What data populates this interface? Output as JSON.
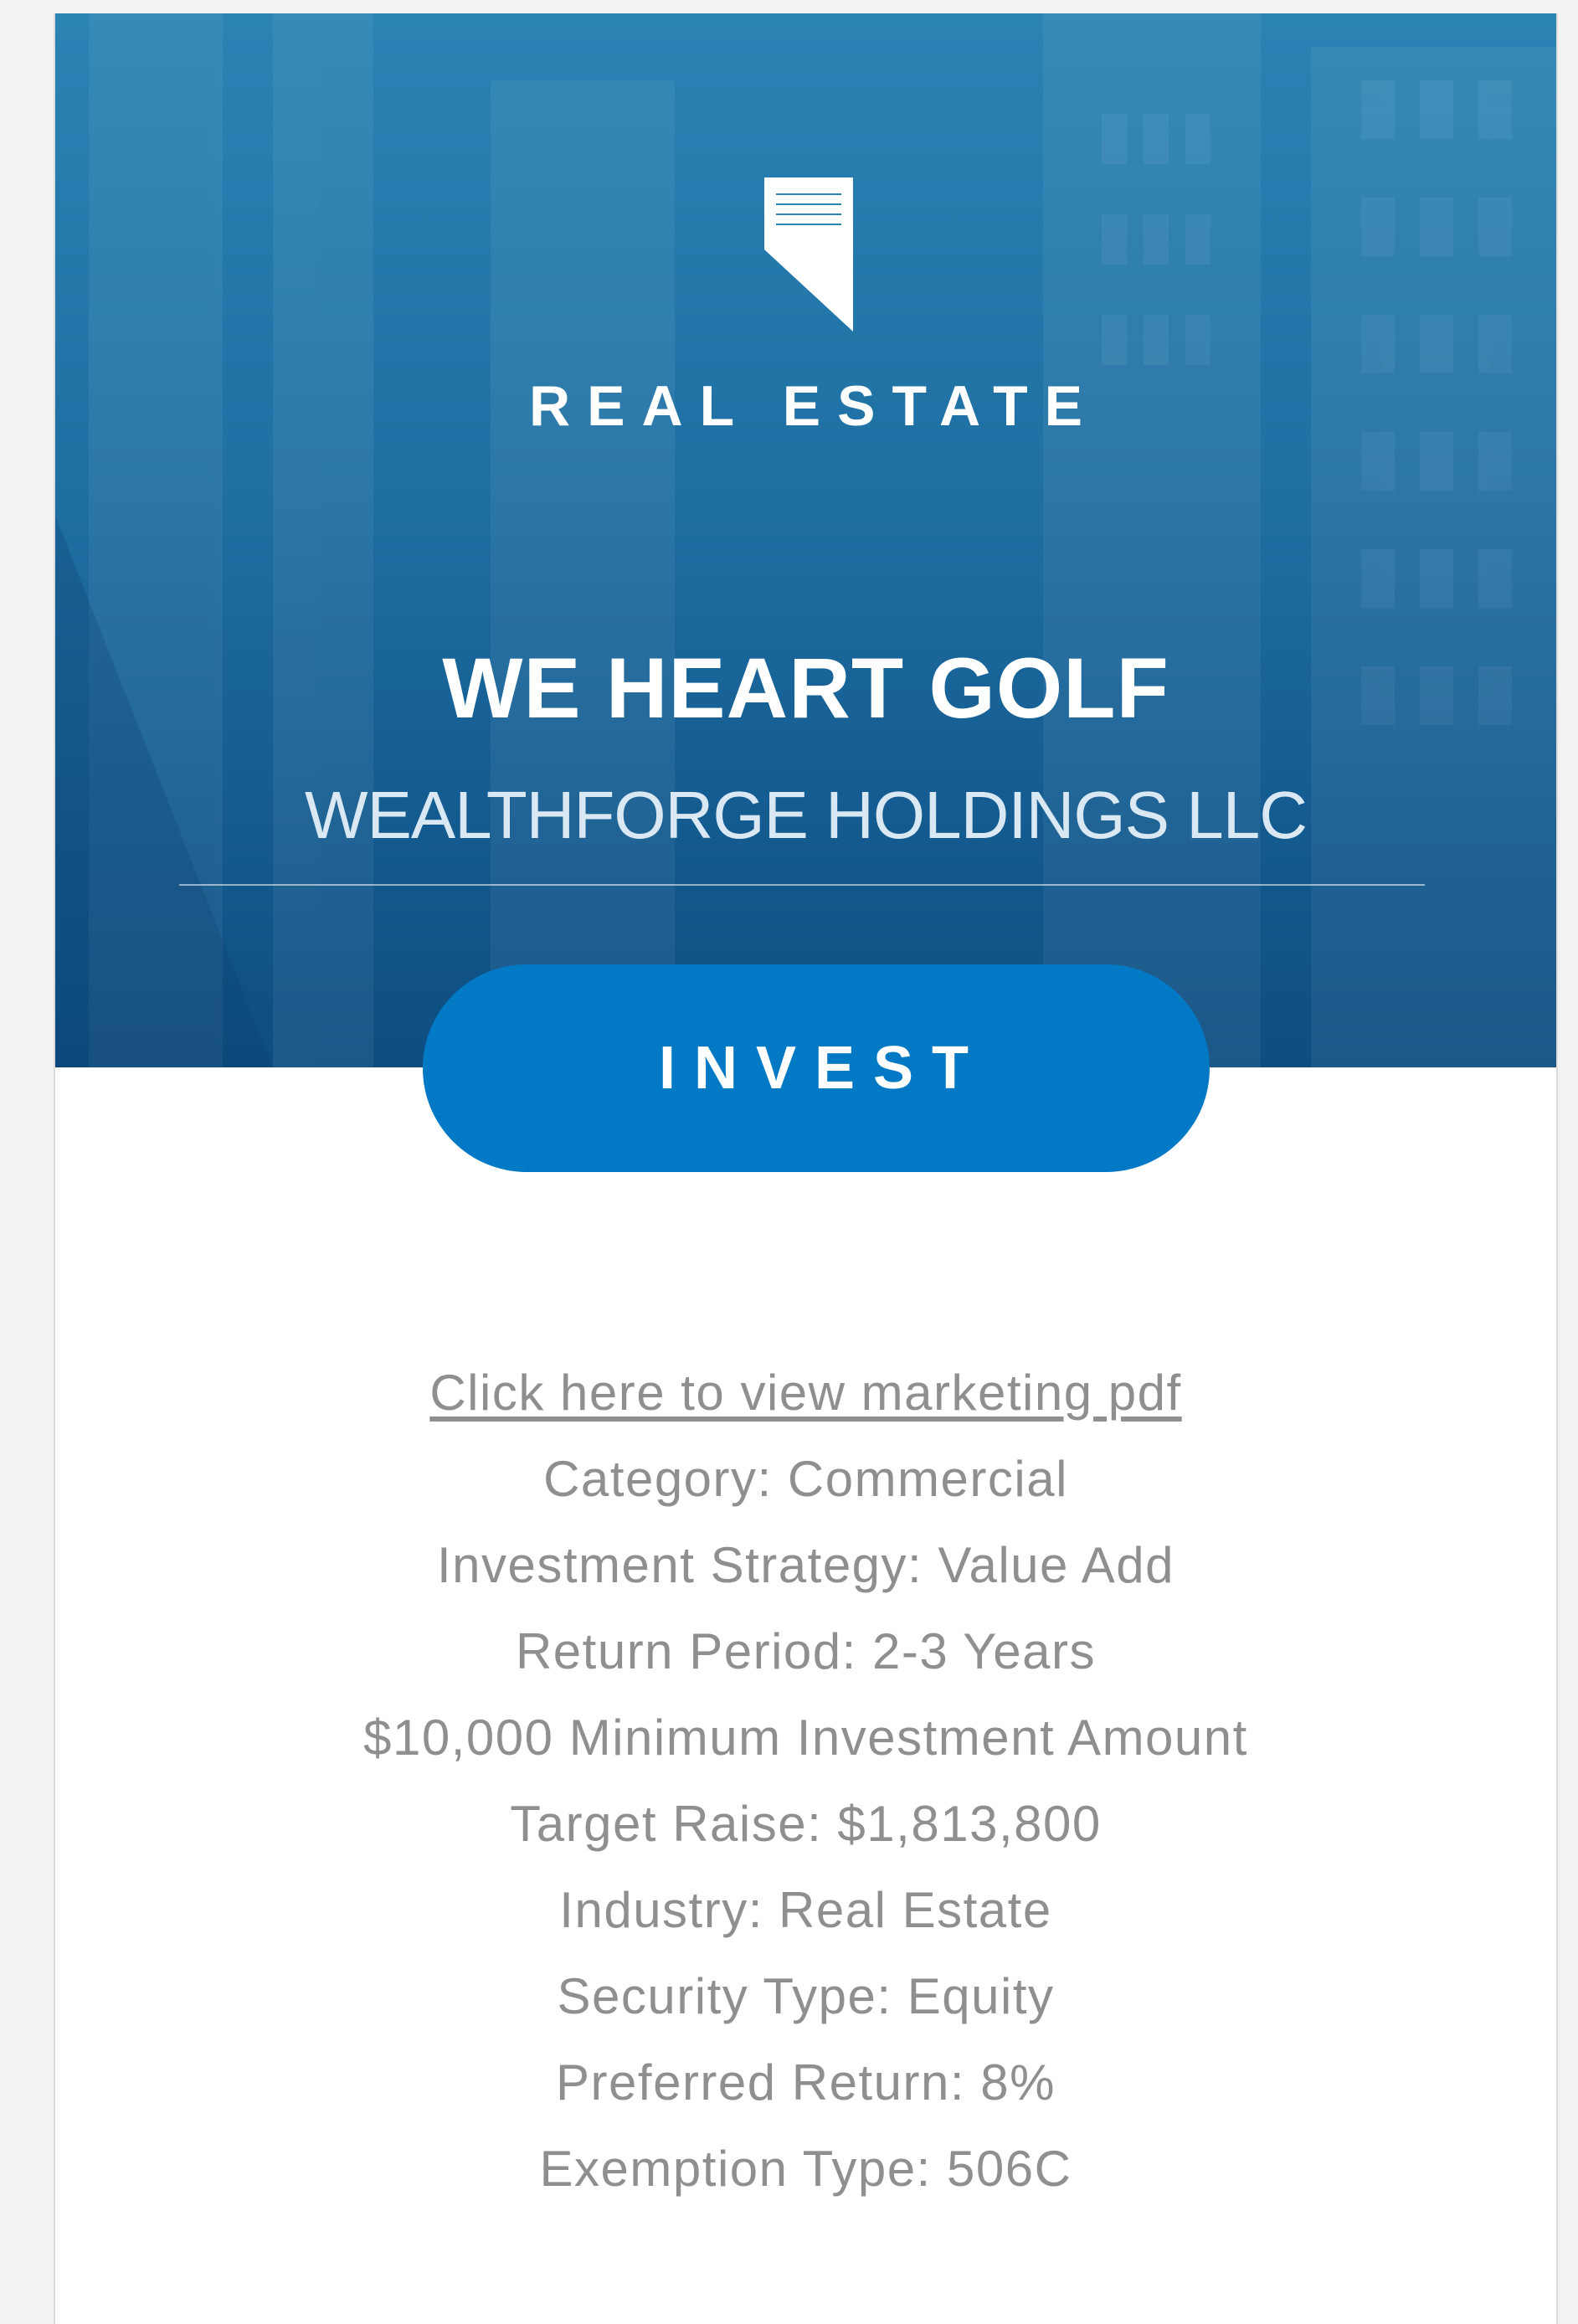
{
  "hero": {
    "category": "REAL ESTATE",
    "title": "WE HEART GOLF",
    "subtitle": "WEALTHFORGE HOLDINGS LLC",
    "logo_icon": "real-estate-logo-icon"
  },
  "invest_button": {
    "label": "INVEST"
  },
  "details": {
    "marketing_link": "Click here to view marketing pdf",
    "lines": [
      "Category: Commercial",
      "Investment Strategy: Value Add",
      "Return Period: 2-3 Years",
      "$10,000 Minimum Investment Amount",
      "Target Raise: $1,813,800",
      "Industry: Real Estate",
      "Security Type: Equity",
      "Preferred Return: 8%",
      "Exemption Type: 506C"
    ]
  },
  "colors": {
    "hero_top": "#2a84b4",
    "hero_bottom": "#0e4d80",
    "button": "#0279c4",
    "detail_text": "#8f8f8f"
  }
}
